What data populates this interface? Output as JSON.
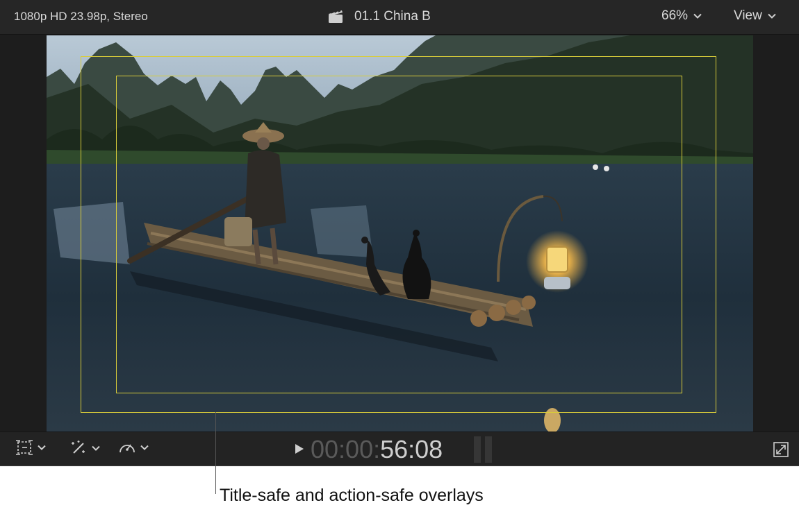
{
  "viewer": {
    "format_info": "1080p HD 23.98p, Stereo",
    "clip_name": "01.1 China B",
    "zoom": "66%",
    "view_menu": "View"
  },
  "playback": {
    "timecode_dim": "00:00:",
    "timecode_lit": "56:08"
  },
  "overlays": {
    "color": "#d8cc3a"
  },
  "icons": {
    "clapper": "clapperboard-icon",
    "zoom_chevron": "chevron-down-icon",
    "view_chevron": "chevron-down-icon",
    "transform": "transform-tool-icon",
    "enhance": "magic-wand-icon",
    "retime": "speedometer-icon",
    "play": "play-icon",
    "fullscreen": "fullscreen-icon"
  },
  "callout": {
    "text": "Title-safe and action-safe overlays"
  }
}
